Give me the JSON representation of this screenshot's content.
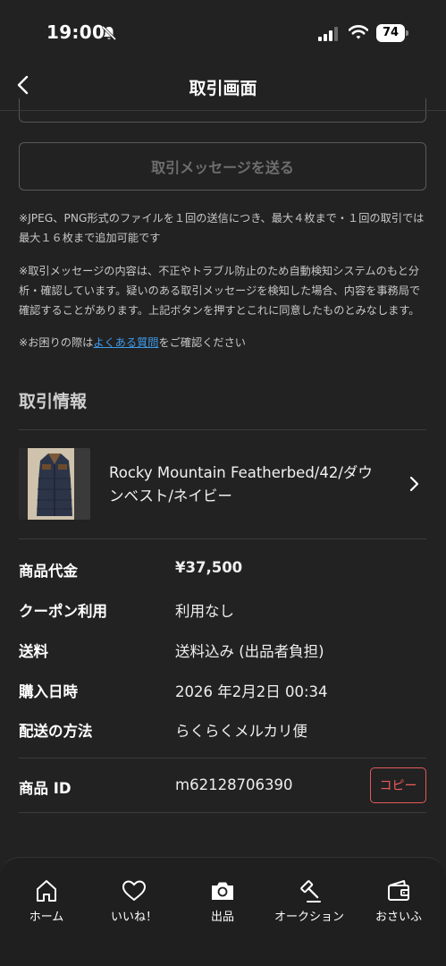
{
  "status_bar": {
    "time": "19:00",
    "battery": "74"
  },
  "header": {
    "title": "取引画面"
  },
  "send_button_label": "取引メッセージを送る",
  "notes": {
    "file_note": "※JPEG、PNG形式のファイルを１回の送信につき、最大４枚まで・１回の取引では最大１６枚まで追加可能です",
    "policy_note": "※取引メッセージの内容は、不正やトラブル防止のため自動検知システムのもと分析・確認しています。疑いのある取引メッセージを検知した場合、内容を事務局で確認することがあります。上記ボタンを押すとこれに同意したものとみなします。",
    "help_prefix": "※お困りの際は",
    "help_link": "よくある質問",
    "help_suffix": "をご確認ください"
  },
  "section_title": "取引情報",
  "item": {
    "title": "Rocky Mountain Featherbed/42/ダウンベスト/ネイビー"
  },
  "details": [
    {
      "key": "商品代金",
      "value": "¥37,500"
    },
    {
      "key": "クーポン利用",
      "value": "利用なし"
    },
    {
      "key": "送料",
      "value": "送料込み (出品者負担)"
    },
    {
      "key": "購入日時",
      "value": "2026 年2月2日 00:34"
    },
    {
      "key": "配送の方法",
      "value": "らくらくメルカリ便"
    }
  ],
  "product_id": {
    "key": "商品 ID",
    "value": "m62128706390",
    "copy_label": "コピー"
  },
  "nav": [
    {
      "label": "ホーム",
      "icon": "home-icon"
    },
    {
      "label": "いいね！",
      "icon": "heart-icon"
    },
    {
      "label": "出品",
      "icon": "camera-icon"
    },
    {
      "label": "オークション",
      "icon": "gavel-icon"
    },
    {
      "label": "おさいふ",
      "icon": "wallet-icon"
    }
  ]
}
